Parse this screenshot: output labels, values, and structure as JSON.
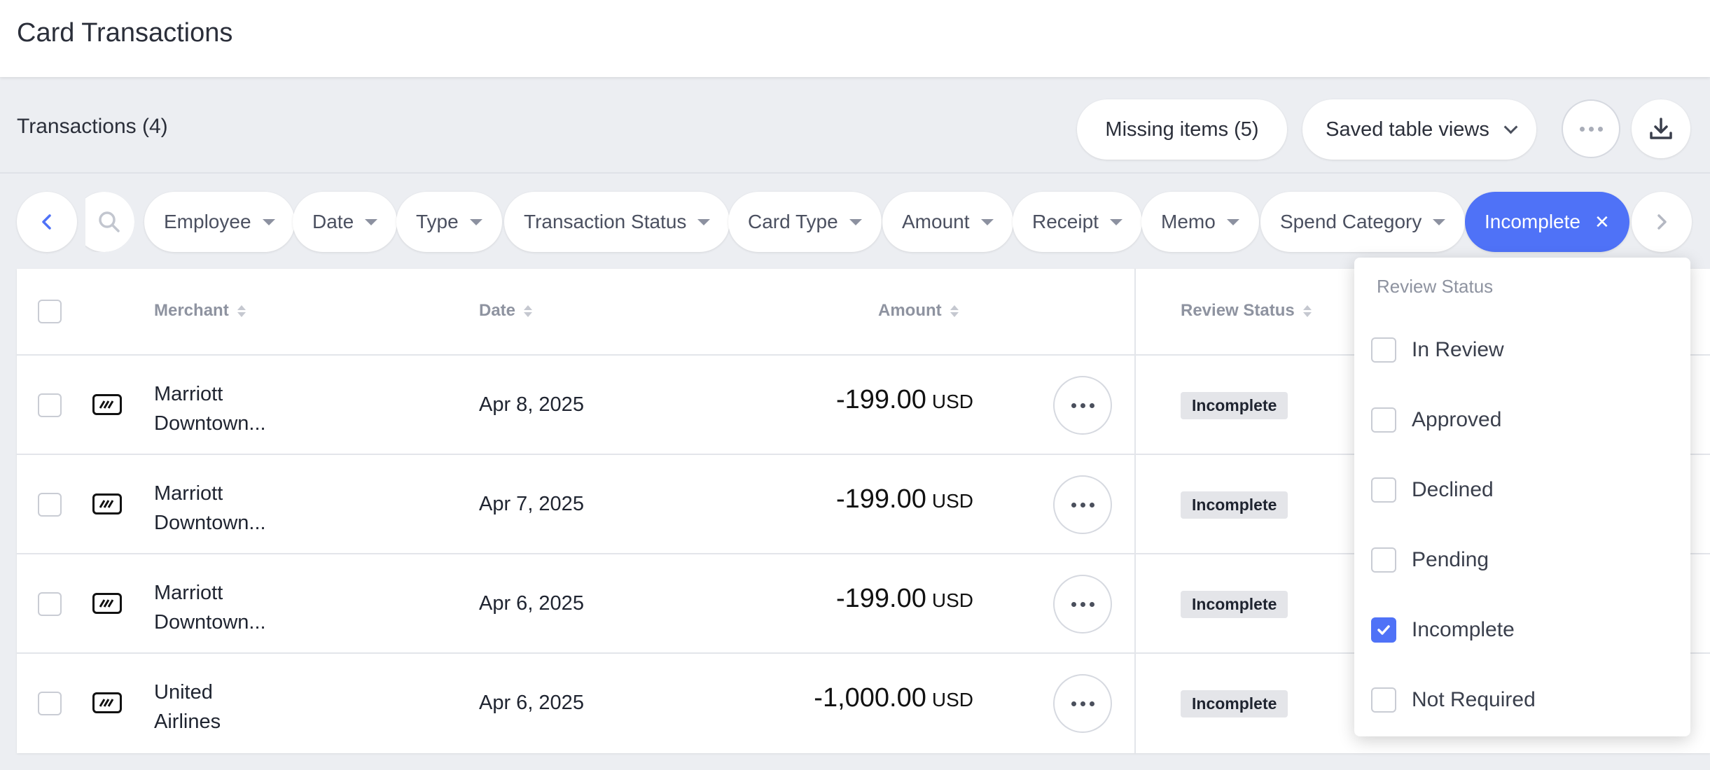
{
  "header": {
    "title": "Card Transactions"
  },
  "toolbar": {
    "count_label": "Transactions (4)",
    "missing_items_label": "Missing items (5)",
    "saved_views_label": "Saved table views",
    "more_icon": "more-dots-icon",
    "download_icon": "download-icon"
  },
  "filters": {
    "back_icon": "chevron-left-icon",
    "search_icon": "search-icon",
    "next_icon": "chevron-right-icon",
    "chips": [
      "Employee",
      "Date",
      "Type",
      "Transaction Status",
      "Card Type",
      "Amount",
      "Receipt",
      "Memo",
      "Spend Category"
    ],
    "active_chip": "Incomplete"
  },
  "table": {
    "columns": {
      "merchant": "Merchant",
      "date": "Date",
      "amount": "Amount",
      "review_status": "Review Status"
    },
    "rows": [
      {
        "merchant_line1": "Marriott",
        "merchant_line2": "Downtown...",
        "date": "Apr 8, 2025",
        "amount": "-199.00",
        "currency": "USD",
        "review_status": "Incomplete"
      },
      {
        "merchant_line1": "Marriott",
        "merchant_line2": "Downtown...",
        "date": "Apr 7, 2025",
        "amount": "-199.00",
        "currency": "USD",
        "review_status": "Incomplete"
      },
      {
        "merchant_line1": "Marriott",
        "merchant_line2": "Downtown...",
        "date": "Apr 6, 2025",
        "amount": "-199.00",
        "currency": "USD",
        "review_status": "Incomplete"
      },
      {
        "merchant_line1": "United",
        "merchant_line2": "Airlines",
        "date": "Apr 6, 2025",
        "amount": "-1,000.00",
        "currency": "USD",
        "review_status": "Incomplete"
      }
    ]
  },
  "review_status_dropdown": {
    "title": "Review Status",
    "options": [
      {
        "label": "In Review",
        "checked": false
      },
      {
        "label": "Approved",
        "checked": false
      },
      {
        "label": "Declined",
        "checked": false
      },
      {
        "label": "Pending",
        "checked": false
      },
      {
        "label": "Incomplete",
        "checked": true
      },
      {
        "label": "Not Required",
        "checked": false
      }
    ]
  },
  "colors": {
    "accent": "#4f72f7",
    "background": "#eceef2",
    "badge_bg": "#e4e5e9"
  }
}
